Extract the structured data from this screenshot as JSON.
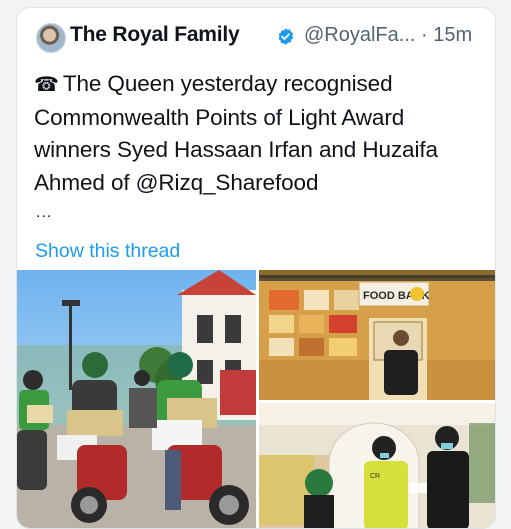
{
  "tweet": {
    "author_name": "The Royal Family",
    "handle": "@RoyalFa...",
    "separator": "·",
    "time": "15m",
    "phone_emoji": "☎",
    "text": "The Queen yesterday recognised Commonwealth Points of Light Award winners Syed Hassaan Irfan and Huzaifa Ahmed of @Rizq_Sharefood",
    "ellipsis": "...",
    "show_thread": "Show this thread"
  },
  "media": {
    "photo_2_sign": "FOOD BANK",
    "photo_3_vest": "CR"
  },
  "colors": {
    "link": "#1d9bf0",
    "verified": "#1d9bf0",
    "secondary_text": "#536471",
    "primary_text": "#0f1419"
  },
  "icons": [
    "avatar",
    "verified-badge-icon",
    "telephone-icon"
  ]
}
